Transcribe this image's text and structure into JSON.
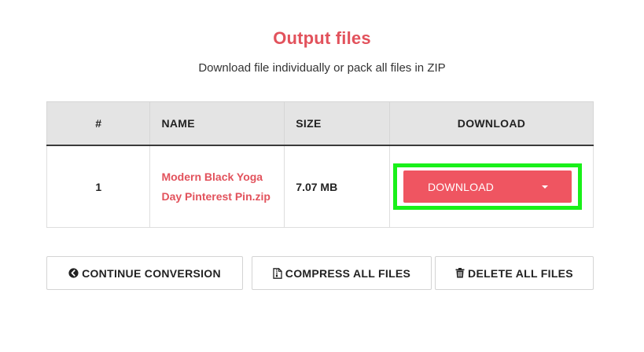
{
  "header": {
    "title": "Output files",
    "subtitle": "Download file individually or pack all files in ZIP"
  },
  "table": {
    "columns": [
      "#",
      "NAME",
      "SIZE",
      "DOWNLOAD"
    ],
    "rows": [
      {
        "index": "1",
        "name": "Modern Black Yoga Day Pinterest Pin.zip",
        "size": "7.07 MB",
        "download_label": "DOWNLOAD"
      }
    ]
  },
  "actions": {
    "continue_label": "CONTINUE CONVERSION",
    "compress_label": "COMPRESS ALL FILES",
    "delete_label": "DELETE ALL FILES"
  },
  "icons": {
    "continue": "arrow-circle-left-icon",
    "compress": "file-zip-icon",
    "delete": "trash-icon",
    "dropdown": "caret-down-icon"
  },
  "colors": {
    "accent": "#e2525c",
    "button": "#ef5561",
    "highlight": "#19f019",
    "header_bg": "#e4e4e4"
  }
}
